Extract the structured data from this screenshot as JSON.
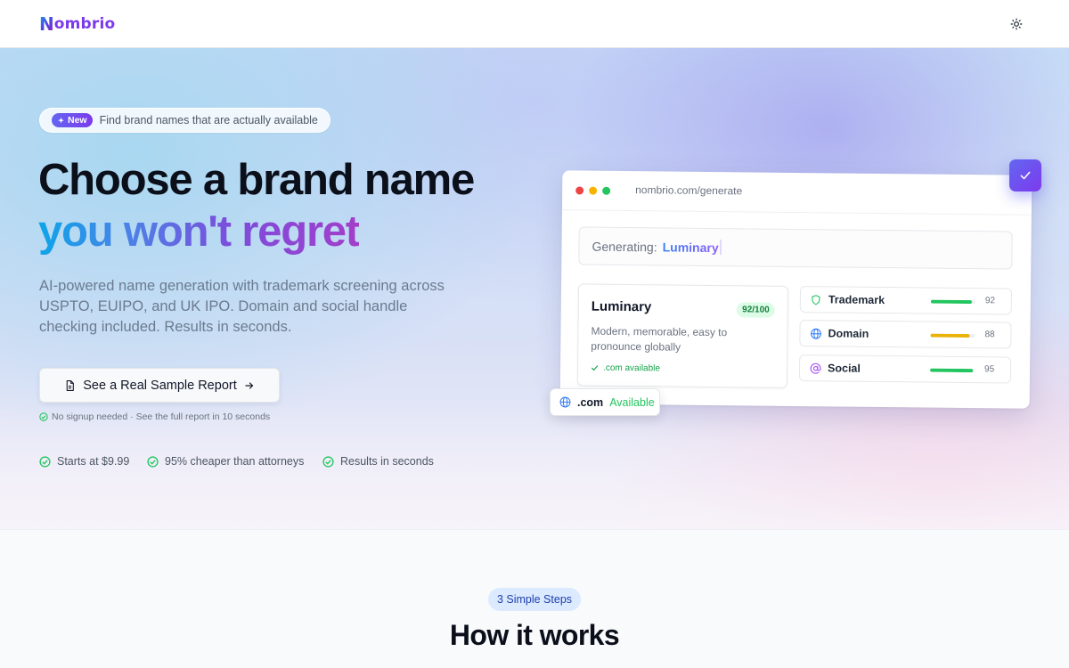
{
  "header": {
    "logo_initial": "N",
    "logo_rest": "ombrio",
    "theme_icon": "sun-icon"
  },
  "hero": {
    "badge_label": "New",
    "badge_text": "Find brand names that are actually available",
    "headline_line1": "Choose a brand name",
    "headline_line2": "you won't regret",
    "subheadline": "AI-powered name generation with trademark screening across USPTO, EUIPO, and UK IPO. Domain and social handle checking included. Results in seconds.",
    "cta_label": "See a Real Sample Report",
    "cta_note": "No signup needed · See the full report in 10 seconds",
    "features": [
      {
        "label": "Starts at $9.99"
      },
      {
        "label": "95% cheaper than attorneys"
      },
      {
        "label": "Results in seconds"
      }
    ]
  },
  "mock": {
    "url": "nombrio.com/generate",
    "generating_label": "Generating:",
    "generating_value": "Luminary",
    "name_card": {
      "name": "Luminary",
      "score": "92/100",
      "description": "Modern, memorable, easy to pronounce globally",
      "availability": ".com available"
    },
    "metrics": [
      {
        "label": "Trademark",
        "value": "92",
        "percent": 92,
        "color": "#22c55e",
        "icon": "shield-icon"
      },
      {
        "label": "Domain",
        "value": "88",
        "percent": 88,
        "color": "#eab308",
        "icon": "globe-icon"
      },
      {
        "label": "Social",
        "value": "95",
        "percent": 95,
        "color": "#22c55e",
        "icon": "at-icon"
      }
    ],
    "chip": {
      "tld": ".com",
      "status": "Available"
    }
  },
  "how_it_works": {
    "badge": "3 Simple Steps",
    "title": "How it works"
  }
}
